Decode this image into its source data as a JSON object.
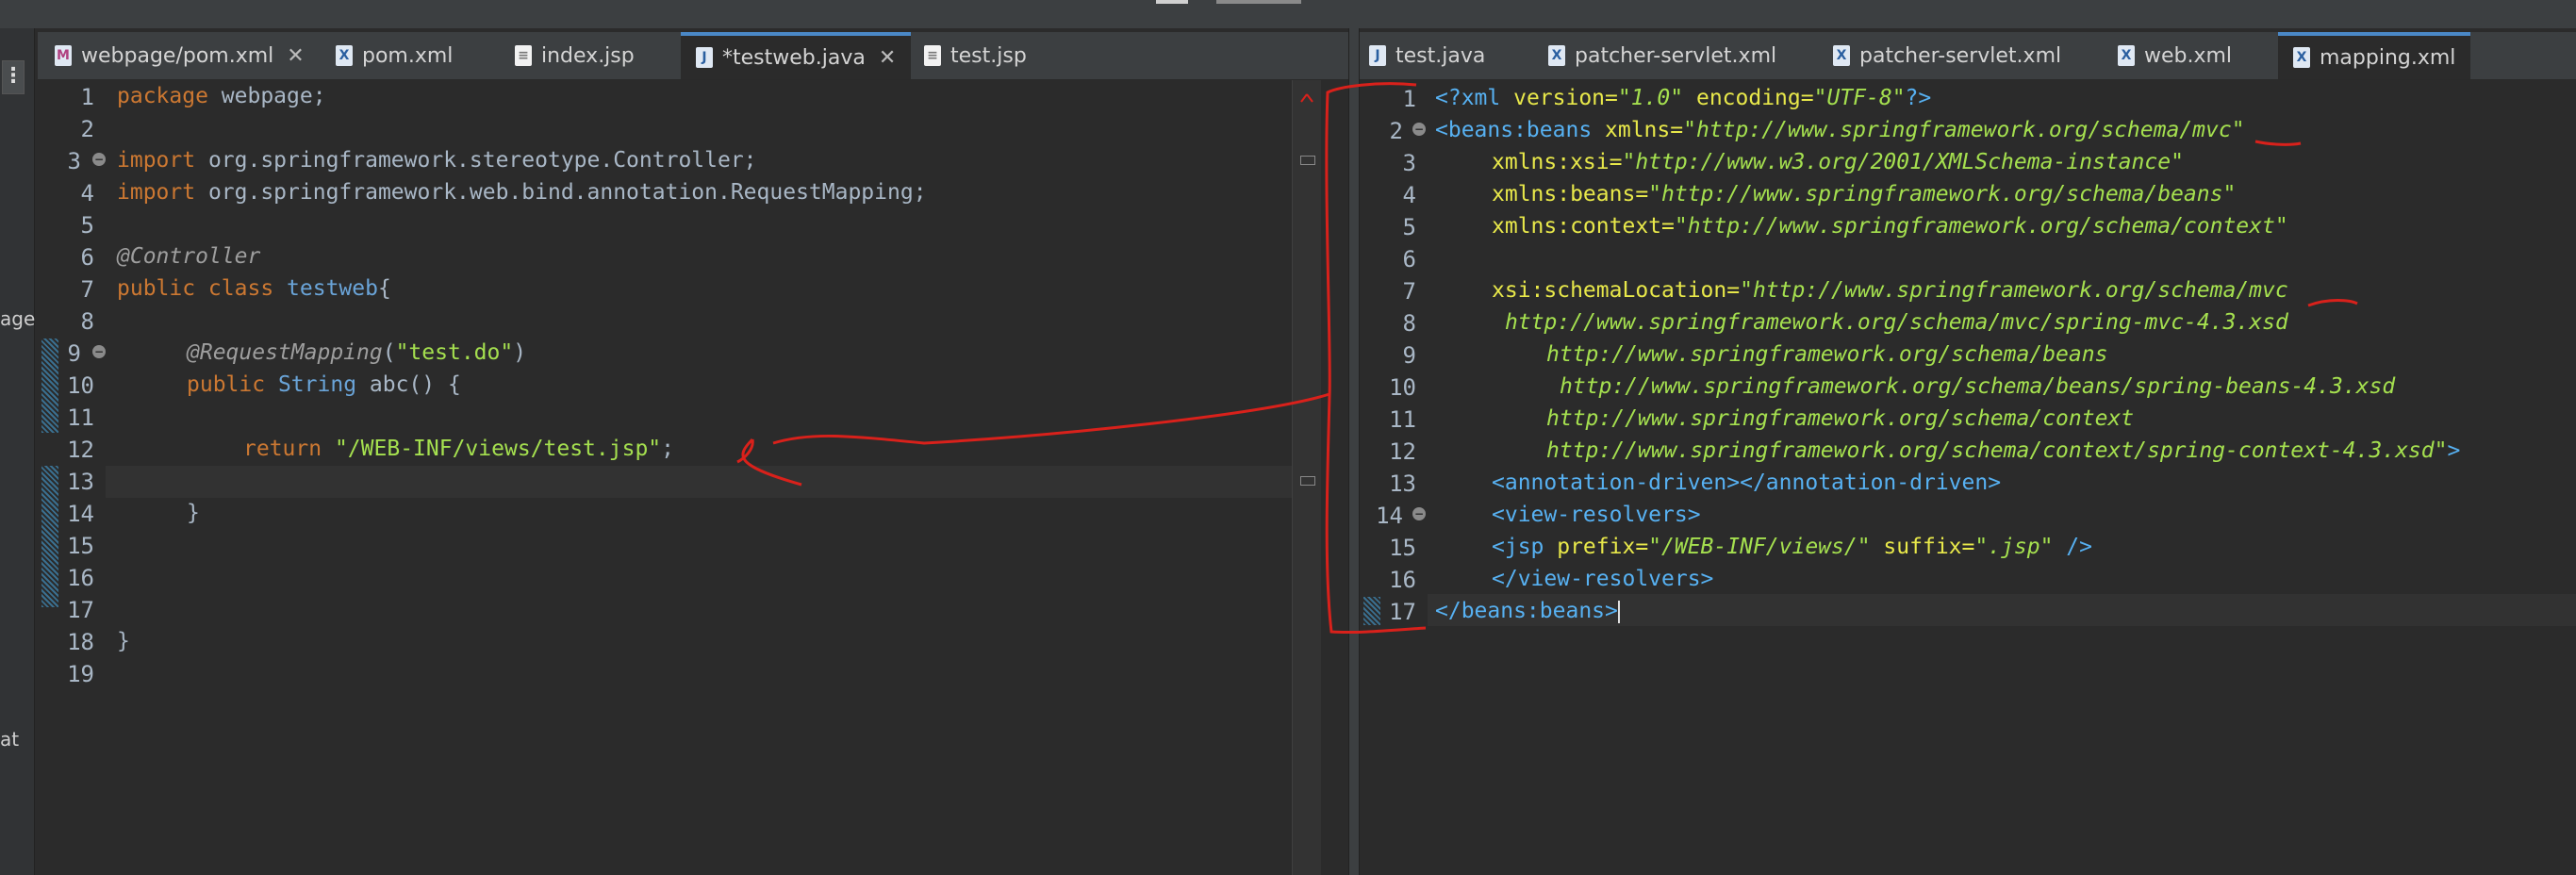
{
  "left_pane": {
    "tabs": [
      {
        "label": "webpage/pom.xml",
        "icon": "maven-pom-icon",
        "active": false,
        "closable": true
      },
      {
        "label": "pom.xml",
        "icon": "xml-file-icon",
        "active": false,
        "closable": false
      },
      {
        "label": "index.jsp",
        "icon": "jsp-file-icon",
        "active": false,
        "closable": false
      },
      {
        "label": "*testweb.java",
        "icon": "java-file-icon",
        "active": true,
        "closable": true
      },
      {
        "label": "test.jsp",
        "icon": "jsp-file-icon",
        "active": false,
        "closable": false
      }
    ],
    "line_numbers": [
      "1",
      "2",
      "3",
      "4",
      "5",
      "6",
      "7",
      "8",
      "9",
      "10",
      "11",
      "12",
      "13",
      "14",
      "15",
      "16",
      "17",
      "18",
      "19"
    ],
    "lines": {
      "l1_kw": "package",
      "l1_rest": " webpage;",
      "l3_kw": "import",
      "l3_rest": " org.springframework.stereotype.Controller;",
      "l4_kw": "import",
      "l4_rest": " org.springframework.web.bind.annotation.RequestMapping;",
      "l6_ann": "@Controller",
      "l7_kw": "public class",
      "l7_name": "testweb",
      "l7_rest": "{",
      "l9_ann": "@RequestMapping",
      "l9_open": "(",
      "l9_str": "\"test.do\"",
      "l9_close": ")",
      "l10_kw": "public",
      "l10_type": "String",
      "l10_rest": " abc() {",
      "l12_kw": "return",
      "l12_str": "\"/WEB-INF/views/test.jsp\"",
      "l12_rest": ";",
      "l14_rest": "}",
      "l18_rest": "}"
    }
  },
  "right_pane": {
    "tabs": [
      {
        "label": "test.java",
        "icon": "java-file-icon",
        "active": false
      },
      {
        "label": "patcher-servlet.xml",
        "icon": "xml-file-icon",
        "active": false
      },
      {
        "label": "patcher-servlet.xml",
        "icon": "xml-file-icon",
        "active": false
      },
      {
        "label": "web.xml",
        "icon": "xml-file-icon",
        "active": false
      },
      {
        "label": "mapping.xml",
        "icon": "xml-file-icon",
        "active": true
      }
    ],
    "line_numbers": [
      "1",
      "2",
      "3",
      "4",
      "5",
      "6",
      "7",
      "8",
      "9",
      "10",
      "11",
      "12",
      "13",
      "14",
      "15",
      "16",
      "17"
    ],
    "lines": {
      "l1_a": "<?xml",
      "l1_b": " version=",
      "l1_c": "\"1.0\"",
      "l1_d": " encoding=",
      "l1_e": "\"UTF-8\"",
      "l1_f": "?>",
      "l2_a": "<beans:beans",
      "l2_b": " xmlns=",
      "l2_c": "\"http://www.springframework.org/schema/mvc\"",
      "l3_a": "xmlns:xsi=",
      "l3_b": "\"http://www.w3.org/2001/XMLSchema-instance\"",
      "l4_a": "xmlns:beans=",
      "l4_b": "\"http://www.springframework.org/schema/beans\"",
      "l5_a": "xmlns:context=",
      "l5_b": "\"http://www.springframework.org/schema/context\"",
      "l7_a": "xsi:schemaLocation=",
      "l7_b": "\"http://www.springframework.org/schema/mvc",
      "l8": "http://www.springframework.org/schema/mvc/spring-mvc-4.3.xsd",
      "l9": "http://www.springframework.org/schema/beans",
      "l10": "http://www.springframework.org/schema/beans/spring-beans-4.3.xsd",
      "l11": "http://www.springframework.org/schema/context",
      "l12_a": "http://www.springframework.org/schema/context/spring-context-4.3.xsd\"",
      "l12_b": ">",
      "l13_a": "<annotation-driven>",
      "l13_b": "</annotation-driven>",
      "l14": "<view-resolvers>",
      "l15_a": "<jsp",
      "l15_b": " prefix=",
      "l15_c": "\"/WEB-INF/views/\"",
      "l15_d": " suffix=",
      "l15_e": "\".jsp\"",
      "l15_f": " />",
      "l16": "</view-resolvers>",
      "l17_a": "</beans:beans",
      "l17_b": ">"
    }
  },
  "left_strip": {
    "fragments": [
      "age",
      "at"
    ]
  }
}
